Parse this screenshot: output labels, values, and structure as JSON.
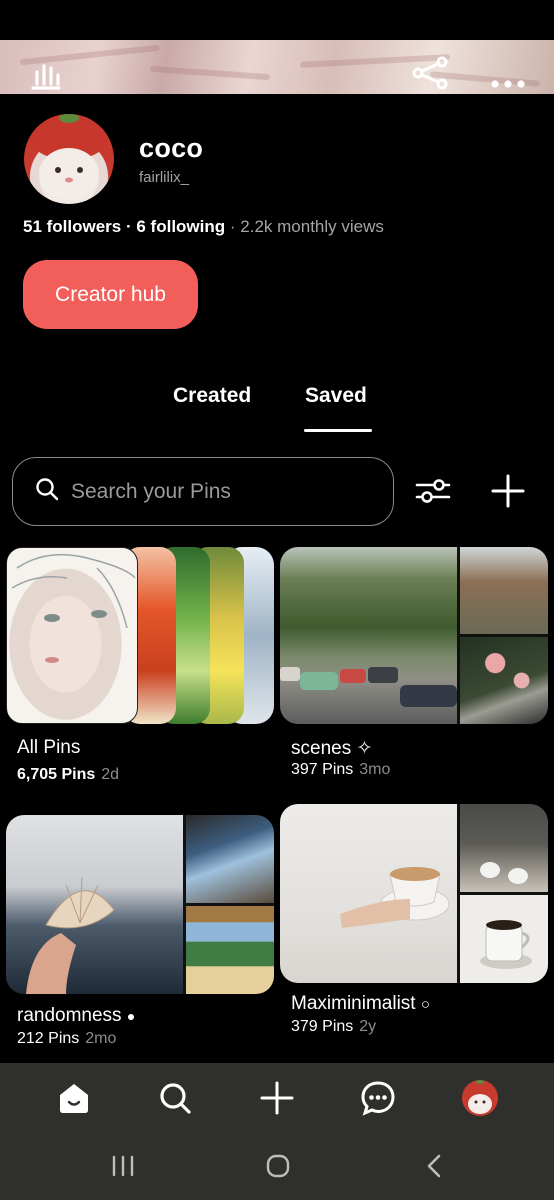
{
  "profile": {
    "name": "coco",
    "handle": "fairlilix_",
    "followers": "51 followers",
    "following": "6 following",
    "monthly_views": "2.2k monthly views",
    "sep1": " · ",
    "sep2": " · "
  },
  "cover_icons": [
    "stats-icon",
    "share-icon",
    "more-icon"
  ],
  "creator_hub_label": "Creator hub",
  "tabs": [
    {
      "label": "Created",
      "selected": false
    },
    {
      "label": "Saved",
      "selected": true
    }
  ],
  "search": {
    "placeholder": "Search your Pins"
  },
  "boards": [
    {
      "title": "All Pins",
      "count": "6,705 Pins",
      "age": "2d",
      "suffix": ""
    },
    {
      "title": "scenes",
      "count": "397 Pins",
      "age": "3mo",
      "suffix": "✧"
    },
    {
      "title": "randomness",
      "count": "212 Pins",
      "age": "2mo",
      "suffix": "●"
    },
    {
      "title": "Maximinimalist",
      "count": "379 Pins",
      "age": "2y",
      "suffix": "○"
    }
  ],
  "bottom_nav": [
    "home-icon",
    "search-icon",
    "create-icon",
    "messages-icon",
    "profile-avatar"
  ],
  "colors": {
    "background": "#000000",
    "accent": "#f25e5a",
    "nav_bg": "#2f2f2c",
    "muted_text": "#a3a3a3"
  }
}
